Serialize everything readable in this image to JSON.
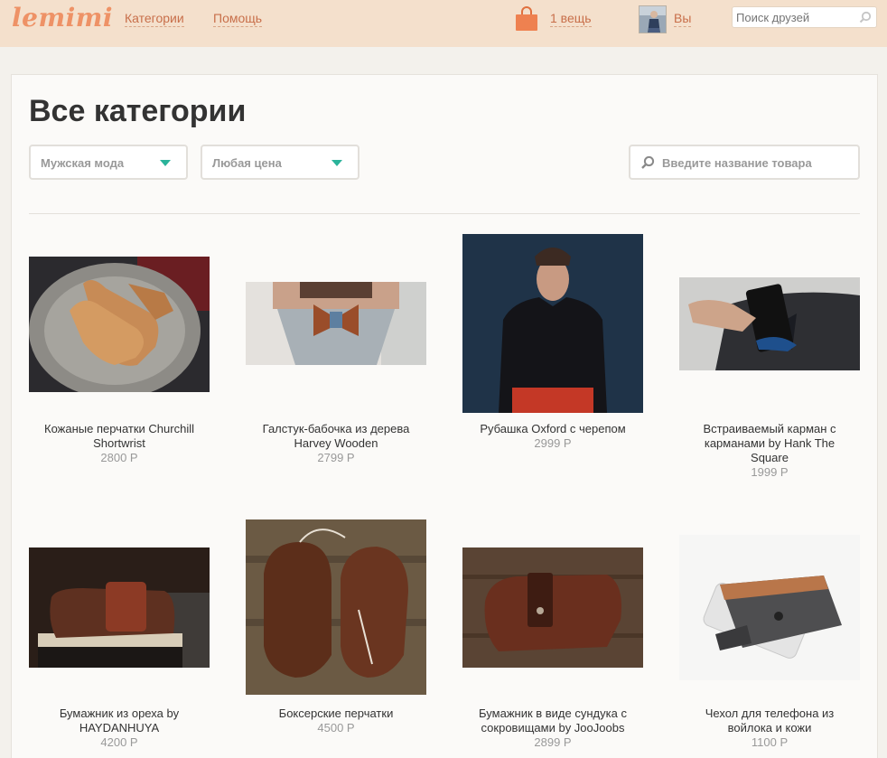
{
  "header": {
    "logo": "lemimi",
    "nav": [
      "Категории",
      "Помощь"
    ],
    "cart_count": "1 вещь",
    "user_label": "Вы",
    "friend_search_placeholder": "Поиск друзей",
    "brand_color": "#ee9266"
  },
  "page": {
    "title": "Все категории",
    "filter_category": "Мужская мода",
    "filter_price": "Любая цена",
    "product_search_placeholder": "Введите название товара",
    "accent_color": "#2bb39a"
  },
  "products": [
    {
      "name_lines": [
        "Кожаные перчатки Churchill",
        "Shortwrist"
      ],
      "price": "2800 Р"
    },
    {
      "name_lines": [
        "Галстук-бабочка из дерева",
        "Harvey Wooden"
      ],
      "price": "2799 Р"
    },
    {
      "name_lines": [
        "Рубашка Oxford с черепом"
      ],
      "price": "2999 Р"
    },
    {
      "name_lines": [
        "Встраиваемый карман с",
        "карманами by Hank The",
        "Square"
      ],
      "price": "1999 Р"
    },
    {
      "name_lines": [
        "Бумажник из ореха by",
        "HAYDANHUYA"
      ],
      "price": "4200 Р"
    },
    {
      "name_lines": [
        "Боксерские перчатки"
      ],
      "price": "4500 Р"
    },
    {
      "name_lines": [
        "Бумажник в виде сундука с",
        "сокровищами by JooJoobs"
      ],
      "price": "2899 Р"
    },
    {
      "name_lines": [
        "Чехол для телефона из",
        "войлока и кожи"
      ],
      "price": "1100 Р"
    }
  ]
}
